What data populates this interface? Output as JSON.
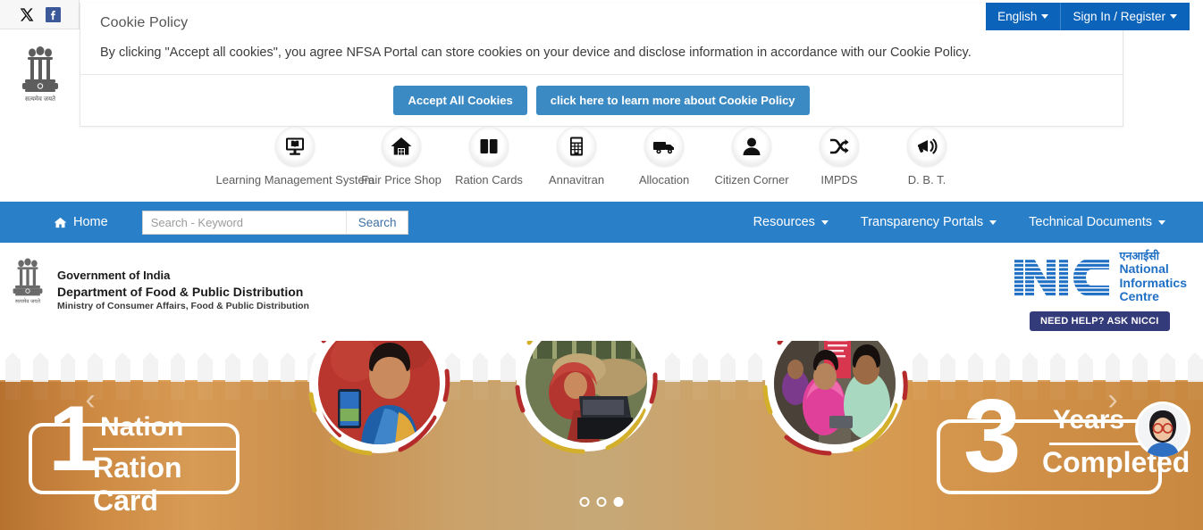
{
  "social": {
    "items": [
      {
        "name": "twitter-x-icon",
        "label": "X"
      },
      {
        "name": "facebook-icon",
        "label": "f"
      }
    ]
  },
  "emblem": {
    "caption": "सत्यमेव जयते"
  },
  "cookie": {
    "title": "Cookie Policy",
    "message": "By clicking \"Accept all cookies\", you agree NFSA Portal can store cookies on your device and disclose information in accordance with our Cookie Policy.",
    "accept_label": "Accept All Cookies",
    "learn_more_label": "click here to learn more about Cookie Policy"
  },
  "header": {
    "language_label": "English",
    "signin_label": "Sign In / Register"
  },
  "quicknav": {
    "items": [
      {
        "label": "Learning Management System",
        "icon": "monitor-book-icon",
        "wide": true
      },
      {
        "label": "Fair Price Shop",
        "icon": "house-icon",
        "wide": false
      },
      {
        "label": "Ration Cards",
        "icon": "open-book-icon",
        "wide": false
      },
      {
        "label": "Annavitran",
        "icon": "calculator-icon",
        "wide": false
      },
      {
        "label": "Allocation",
        "icon": "truck-icon",
        "wide": false
      },
      {
        "label": "Citizen Corner",
        "icon": "person-icon",
        "wide": false
      },
      {
        "label": "IMPDS",
        "icon": "shuffle-icon",
        "wide": false
      },
      {
        "label": "D. B. T.",
        "icon": "megaphone-icon",
        "wide": false
      }
    ]
  },
  "nav": {
    "home_label": "Home",
    "search_placeholder": "Search - Keyword",
    "search_value": "",
    "search_button_label": "Search",
    "menus": [
      {
        "label": "Resources"
      },
      {
        "label": "Transparency Portals"
      },
      {
        "label": "Technical Documents"
      }
    ]
  },
  "branding": {
    "line1": "Government of India",
    "line2": "Department of Food & Public Distribution",
    "line3": "Ministry of Consumer Affairs, Food & Public Distribution"
  },
  "nic": {
    "mark": "NIC",
    "hindi": "एनआईसी",
    "line1": "National",
    "line2": "Informatics",
    "line3": "Centre",
    "help_badge": "NEED HELP? ASK NICCI"
  },
  "hero": {
    "left_slogan": {
      "number": "1",
      "word1": "Nation",
      "word2": "Ration Card"
    },
    "right_slogan": {
      "number": "3",
      "word1": "Years",
      "word2": "Completed"
    },
    "dots": [
      {
        "active": false
      },
      {
        "active": false
      },
      {
        "active": true
      }
    ],
    "prev_label": "‹",
    "next_label": "›"
  },
  "colors": {
    "nav_blue": "#2a7fc9",
    "header_blue": "#0b63ba",
    "cookie_btn": "#3b8ac4",
    "nic_blue": "#1f6fc4",
    "badge_navy": "#343b7a"
  }
}
